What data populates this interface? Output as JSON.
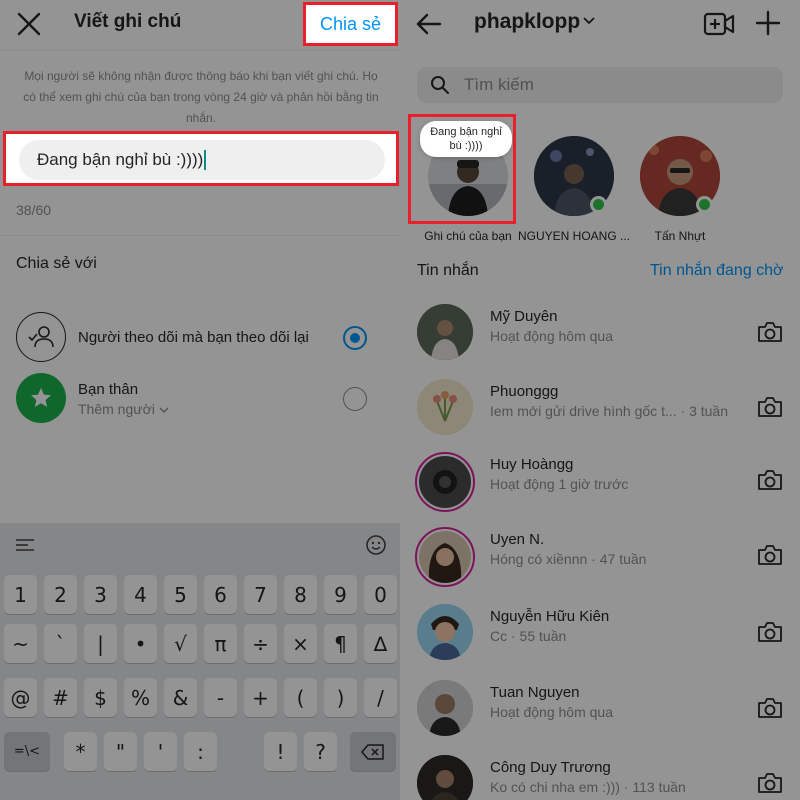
{
  "left": {
    "title": "Viết ghi chú",
    "share_button": "Chia sẻ",
    "info_text": "Mọi người sẽ không nhận được thông báo khi bạn viết ghi chú. Họ có thể xem ghi chú của bạn trong vòng 24 giờ và phản hồi bằng tin nhắn.",
    "note_value": "Đang bận nghỉ bù :))))",
    "char_count": "38/60",
    "share_with_title": "Chia sẻ với",
    "options": [
      {
        "label": "Người theo dõi mà bạn theo dõi lại",
        "sub": "",
        "selected": true,
        "icon": "followers-icon"
      },
      {
        "label": "Bạn thân",
        "sub": "Thêm người",
        "selected": false,
        "icon": "star-icon"
      }
    ],
    "keyboard": {
      "row1": [
        "1",
        "2",
        "3",
        "4",
        "5",
        "6",
        "7",
        "8",
        "9",
        "0"
      ],
      "row2": [
        "~",
        "`",
        "|",
        "•",
        "√",
        "π",
        "÷",
        "×",
        "¶",
        "∆"
      ],
      "row3": [
        "@",
        "#",
        "$",
        "%",
        "&",
        "-",
        "+",
        "(",
        ")",
        "/"
      ],
      "row4": [
        "=\\<",
        "*",
        "\"",
        "'",
        ":",
        "!",
        "?"
      ]
    },
    "accent": "#0095f6",
    "highlight_color": "#e8202b"
  },
  "right": {
    "username": "phapklopp",
    "search_placeholder": "Tìm kiếm",
    "note_bubble": "Đang bận nghỉ bù :))))",
    "stories": [
      {
        "label": "Ghi chú của bạn",
        "online": false
      },
      {
        "label": "NGUYEN HOANG ...",
        "online": true
      },
      {
        "label": "Tấn Nhựt",
        "online": true
      }
    ],
    "messages_title": "Tin nhắn",
    "requests_title": "Tin nhắn đang chờ",
    "messages": [
      {
        "name": "Mỹ Duyên",
        "sub": "Hoạt động hôm qua",
        "ring": false
      },
      {
        "name": "Phuonggg",
        "sub": "Iem mới gửi drive hình gốc t... · 3 tuần",
        "ring": false
      },
      {
        "name": "Huy Hoàngg",
        "sub": "Hoạt động 1 giờ trước",
        "ring": true
      },
      {
        "name": "Uyen N.",
        "sub": "Hóng có xiềnnn · 47 tuần",
        "ring": true
      },
      {
        "name": "Nguyễn Hữu Kiên",
        "sub": "Cc · 55 tuần",
        "ring": false
      },
      {
        "name": "Tuan Nguyen",
        "sub": "Hoạt động hôm qua",
        "ring": false
      },
      {
        "name": "Công Duy Trương",
        "sub": "Ko có chi nha em :))) · 113 tuần",
        "ring": false
      }
    ],
    "online_color": "#31c447"
  }
}
